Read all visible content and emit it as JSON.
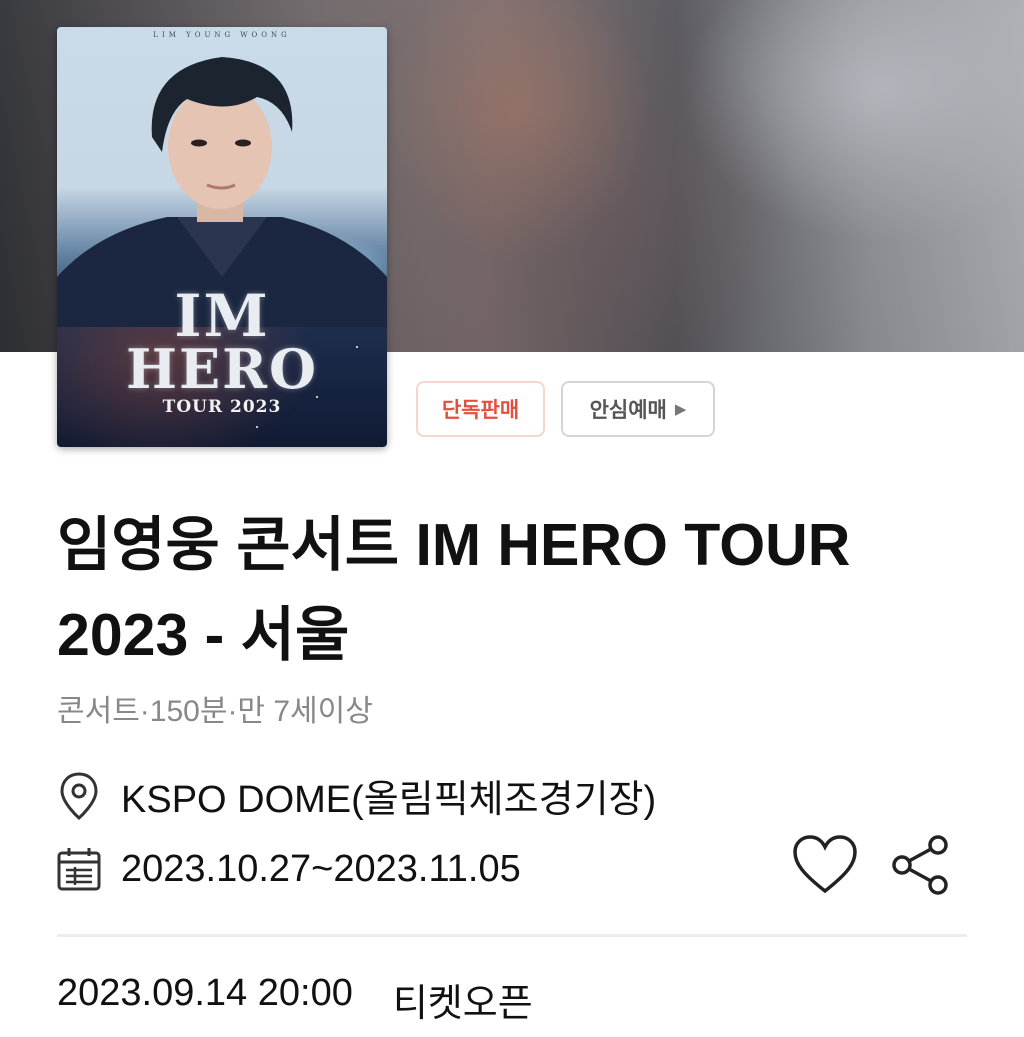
{
  "poster": {
    "header_text": "LIM YOUNG WOONG",
    "title_line1": "IM",
    "title_line2": "HERO",
    "tour_text": "TOUR 2023"
  },
  "badges": {
    "exclusive": "단독판매",
    "safe_booking": "안심예매"
  },
  "event": {
    "title": "임영웅 콘서트 IM HERO TOUR 2023 - 서울",
    "meta": "콘서트·150분·만 7세이상",
    "venue": "KSPO DOME(올림픽체조경기장)",
    "date_range": "2023.10.27~2023.11.05"
  },
  "ticket_open": {
    "datetime": "2023.09.14 20:00",
    "label": "티켓오픈"
  },
  "icons": {
    "venue": "location-pin-icon",
    "date": "calendar-icon",
    "like": "heart-icon",
    "share": "share-icon",
    "badge_arrow": "caret-right-icon"
  },
  "colors": {
    "exclusive_text": "#e4503a",
    "exclusive_border": "#f6d6cf",
    "meta_text": "#888888"
  }
}
